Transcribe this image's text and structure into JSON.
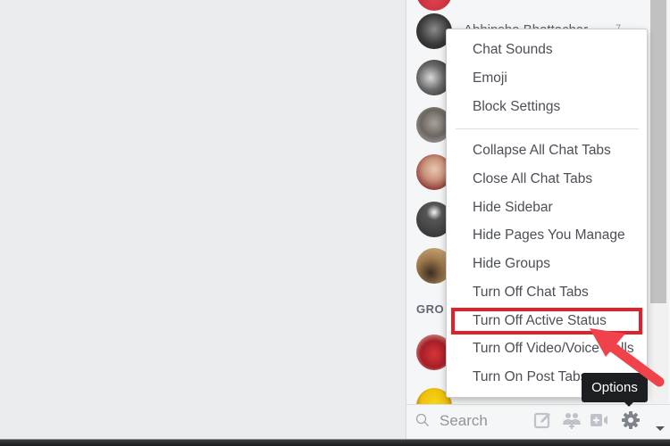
{
  "sidebar": {
    "contacts": [
      {
        "name": "Abhipsha Bhattachar",
        "status": "7"
      }
    ],
    "group_label": "GRO",
    "search": {
      "placeholder": "Search"
    }
  },
  "options_menu": {
    "sections": [
      {
        "items": [
          "Chat Sounds",
          "Emoji",
          "Block Settings"
        ]
      },
      {
        "items": [
          "Collapse All Chat Tabs",
          "Close All Chat Tabs",
          "Hide Sidebar",
          "Hide Pages You Manage",
          "Hide Groups",
          "Turn Off Chat Tabs",
          "Turn Off Active Status",
          "Turn Off Video/Voice Calls",
          "Turn On Post Tabs"
        ]
      }
    ],
    "highlighted_item": "Turn Off Active Status"
  },
  "tooltip": {
    "text": "Options"
  },
  "bottom_bar": {
    "icons": [
      "search-icon",
      "compose-icon",
      "create-group-icon",
      "video-call-icon",
      "gear-icon"
    ]
  },
  "colors": {
    "annotation_red": "#e0202a",
    "arrow_red": "#f0424b",
    "background": "#e9ebee",
    "menu_text": "#4b4f56"
  }
}
